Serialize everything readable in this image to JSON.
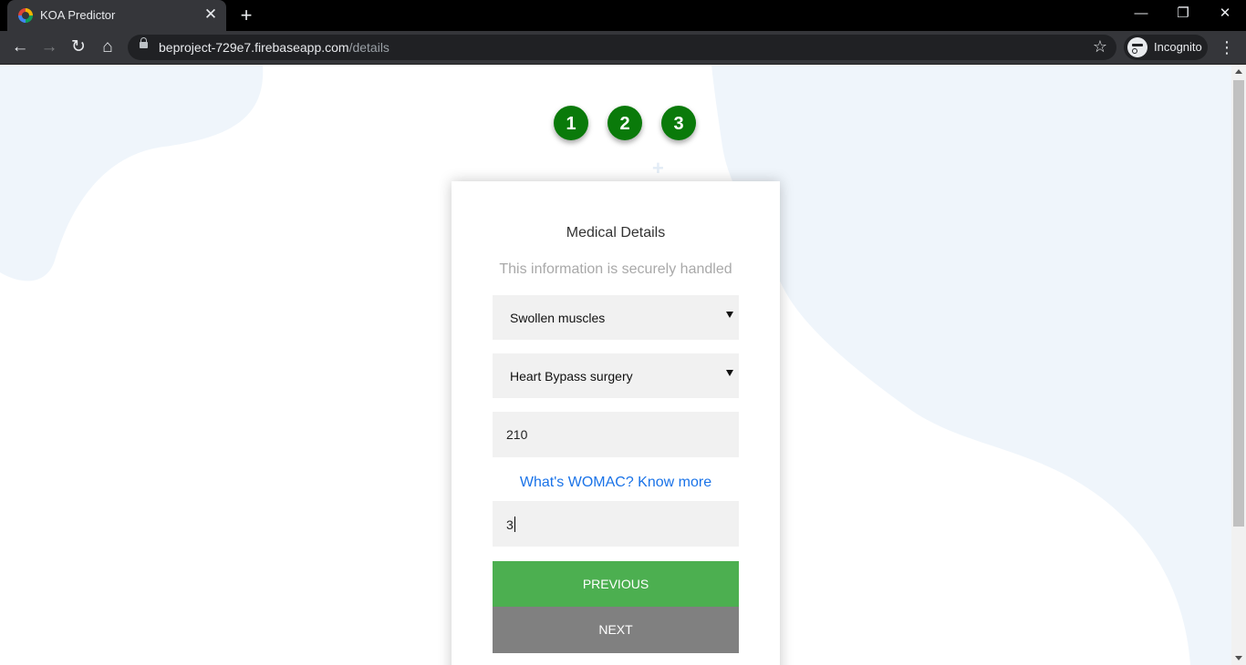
{
  "browser": {
    "tab_title": "KOA Predictor",
    "tab_close": "✕",
    "new_tab": "+",
    "url_host": "beproject-729e7.firebaseapp.com",
    "url_path": "/details",
    "profile_label": "Incognito",
    "window_controls": {
      "minimize": "—",
      "restore": "❐",
      "close": "✕"
    },
    "nav": {
      "back": "←",
      "forward": "→",
      "reload": "↻",
      "home": "⌂",
      "star": "☆",
      "menu": "⋮"
    }
  },
  "stepper": {
    "steps": [
      "1",
      "2",
      "3"
    ],
    "step_color": "#0a7a0a"
  },
  "form": {
    "title": "Medical Details",
    "subtitle": "This information is securely handled",
    "symptom_select": {
      "value": "Swollen muscles"
    },
    "surgery_select": {
      "value": "Heart Bypass surgery"
    },
    "number_input": {
      "value": "210"
    },
    "womac_link": "What's WOMAC? Know more",
    "womac_input": {
      "value": "3"
    },
    "previous_label": "PREVIOUS",
    "next_label": "NEXT"
  },
  "colors": {
    "previous_button": "#4caf50",
    "next_button": "#808080",
    "link": "#1a73e8",
    "background_blob": "#eff5fb"
  }
}
